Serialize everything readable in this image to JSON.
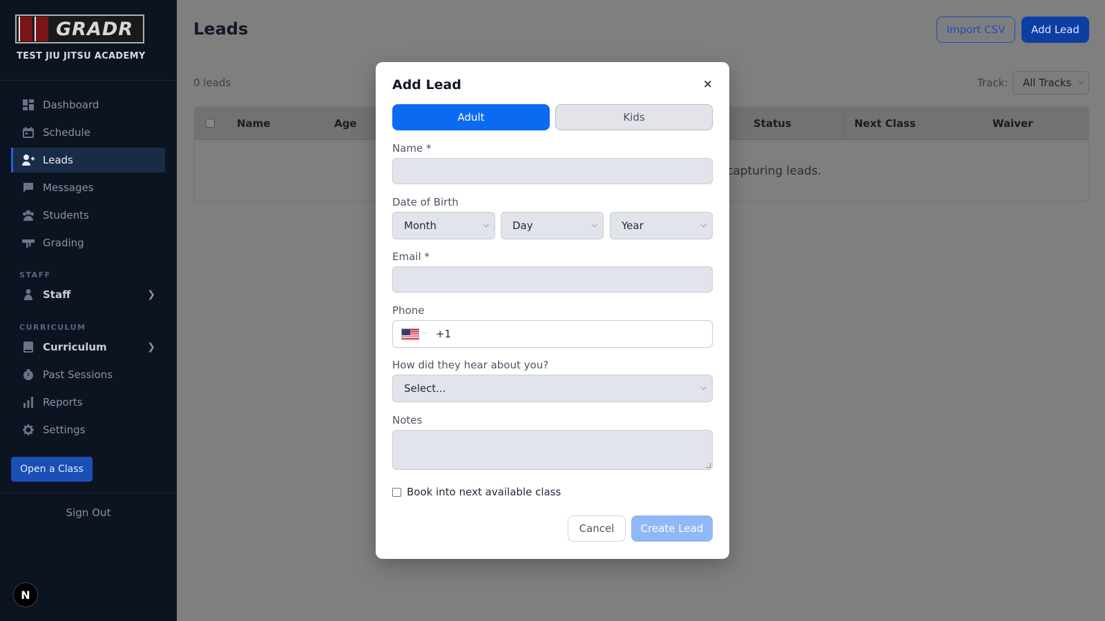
{
  "sidebar": {
    "logo_text": "GRADR",
    "academy_name": "TEST JIU JITSU ACADEMY",
    "items": [
      {
        "label": "Dashboard",
        "icon": "dashboard-icon"
      },
      {
        "label": "Schedule",
        "icon": "calendar-icon"
      },
      {
        "label": "Leads",
        "icon": "user-plus-icon",
        "active": true
      },
      {
        "label": "Messages",
        "icon": "message-icon"
      },
      {
        "label": "Students",
        "icon": "students-icon"
      },
      {
        "label": "Grading",
        "icon": "grading-icon"
      }
    ],
    "staff_section": "STAFF",
    "staff_item": "Staff",
    "curriculum_section": "CURRICULUM",
    "curriculum_items": [
      {
        "label": "Curriculum",
        "icon": "book-icon"
      },
      {
        "label": "Past Sessions",
        "icon": "timer-icon"
      },
      {
        "label": "Reports",
        "icon": "bar-chart-icon"
      },
      {
        "label": "Settings",
        "icon": "gear-icon"
      }
    ],
    "open_class_label": "Open a Class",
    "sign_out_label": "Sign Out",
    "avatar_letter": "N"
  },
  "header": {
    "title": "Leads",
    "import_label": "Import CSV",
    "add_label": "Add Lead"
  },
  "toolbar": {
    "lead_count": "0 leads",
    "track_label": "Track:",
    "track_value": "All Tracks"
  },
  "table": {
    "columns": [
      "Name",
      "Age",
      "Status",
      "Next Class",
      "Waiver"
    ],
    "empty_message": "capturing leads."
  },
  "modal": {
    "title": "Add Lead",
    "close": "×",
    "tab_adult": "Adult",
    "tab_kids": "Kids",
    "name_label": "Name *",
    "dob_label": "Date of Birth",
    "dob_month": "Month",
    "dob_day": "Day",
    "dob_year": "Year",
    "email_label": "Email *",
    "phone_label": "Phone",
    "phone_code": "+1",
    "hear_label": "How did they hear about you?",
    "hear_value": "Select...",
    "notes_label": "Notes",
    "book_label": "Book into next available class",
    "cancel_label": "Cancel",
    "create_label": "Create Lead"
  },
  "colors": {
    "primary": "#0a6bf0",
    "sidebar_bg": "#0c1321",
    "create_disabled": "#8fb8f5"
  }
}
